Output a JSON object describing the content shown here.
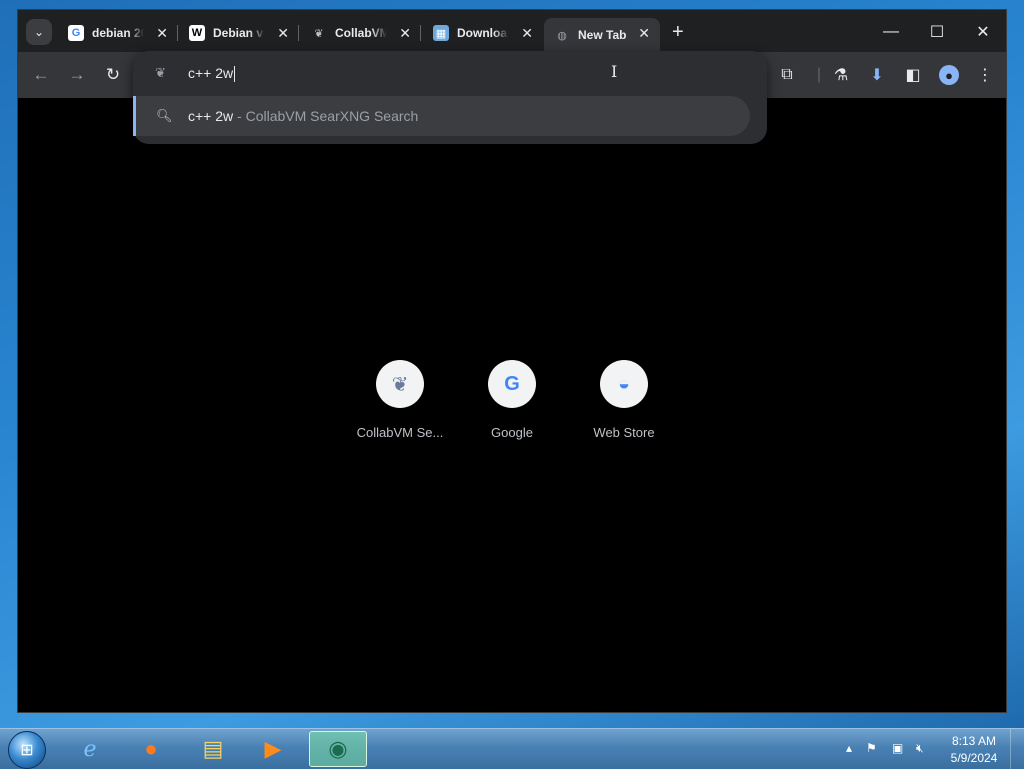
{
  "browser": {
    "tabs": [
      {
        "title": "debian 20",
        "favicon": "G",
        "active": false
      },
      {
        "title": "Debian v",
        "favicon": "W",
        "active": false
      },
      {
        "title": "CollabVM",
        "favicon": "collabvm-icon",
        "active": false
      },
      {
        "title": "Downloa",
        "favicon": "download-page-icon",
        "active": false
      },
      {
        "title": "New Tab",
        "favicon": "globe-icon",
        "active": true
      }
    ],
    "close_glyph": "✕",
    "new_tab_glyph": "+",
    "omnibox": {
      "input_value": "c++ 2w",
      "suggestion_query": "c++ 2w",
      "suggestion_desc": " - CollabVM SearXNG Search"
    },
    "shortcuts": [
      {
        "label": "CollabVM Se...",
        "icon": "collabvm-icon"
      },
      {
        "label": "Google",
        "icon": "google-icon"
      },
      {
        "label": "Web Store",
        "icon": "web-store-icon"
      }
    ]
  },
  "taskbar": {
    "clock_time": "8:13 AM",
    "clock_date": "5/9/2024",
    "pinned": [
      "internet-explorer",
      "firefox",
      "file-explorer",
      "media-player",
      "collabvm-app"
    ]
  },
  "colors": {
    "accent": "#8ab4f8",
    "window_bg": "#202124",
    "toolbar_bg": "#35363a",
    "content_bg": "#000000"
  }
}
